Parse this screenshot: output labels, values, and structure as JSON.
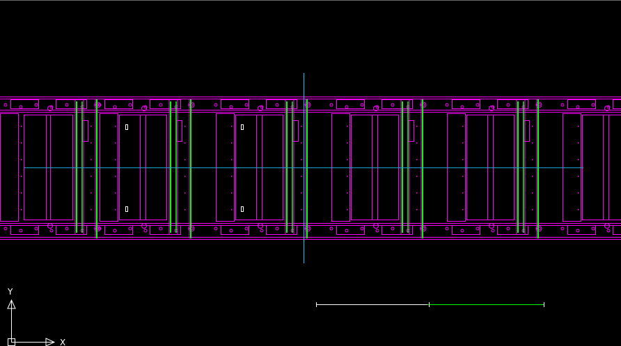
{
  "canvas": {
    "background": "#000000",
    "colors": {
      "outline": "#ff00ff",
      "stiffener": "#00ff00",
      "crosshair": "#00c8ff",
      "centerline": "#1aa0d0",
      "ucs": "#ffffff",
      "dim_line": "#ffffff",
      "dim_ticks": "#00ff00"
    }
  },
  "ucs": {
    "y_label": "Y",
    "x_label": "X",
    "icon": "ucs-axis-icon"
  },
  "cursor": {
    "icon": "crosshair-cursor-icon"
  },
  "drawing": {
    "bays": 6,
    "description_icon": "structural-section-drawing"
  }
}
